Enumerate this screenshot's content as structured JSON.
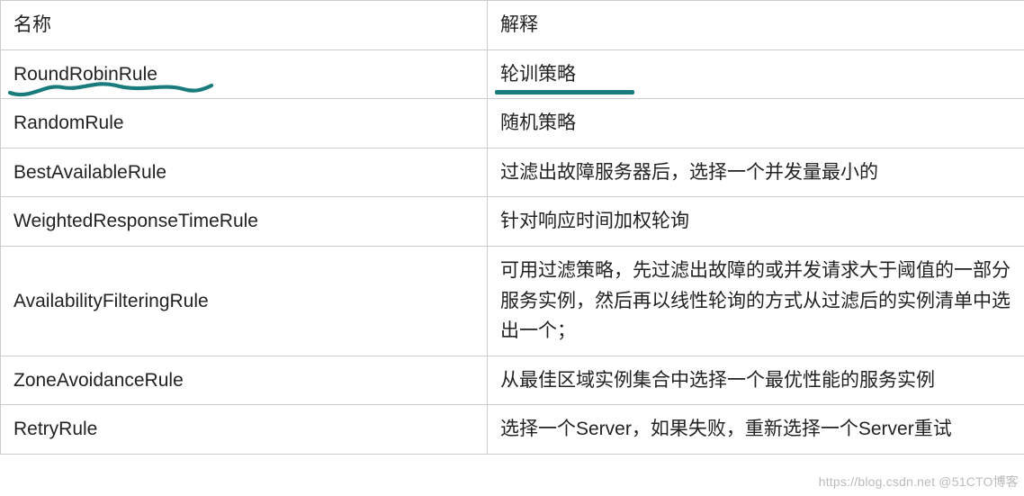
{
  "table": {
    "header": {
      "col1": "名称",
      "col2": "解释"
    },
    "rows": [
      {
        "name": "RoundRobinRule",
        "desc": "轮训策略",
        "note": "highlighted-wavy"
      },
      {
        "name": "RandomRule",
        "desc": "随机策略"
      },
      {
        "name": "BestAvailableRule",
        "desc": "过滤出故障服务器后，选择一个并发量最小的"
      },
      {
        "name": "WeightedResponseTimeRule",
        "desc": "针对响应时间加权轮询"
      },
      {
        "name": "AvailabilityFilteringRule",
        "desc": "可用过滤策略，先过滤出故障的或并发请求大于阈值的一部分服务实例，然后再以线性轮询的方式从过滤后的实例清单中选出一个；"
      },
      {
        "name": "ZoneAvoidanceRule",
        "desc": "从最佳区域实例集合中选择一个最优性能的服务实例"
      },
      {
        "name": "RetryRule",
        "desc": "选择一个Server，如果失败，重新选择一个Server重试"
      }
    ]
  },
  "annotation": {
    "color": "#197b7b"
  },
  "watermark": "https://blog.csdn.net @51CTO博客"
}
